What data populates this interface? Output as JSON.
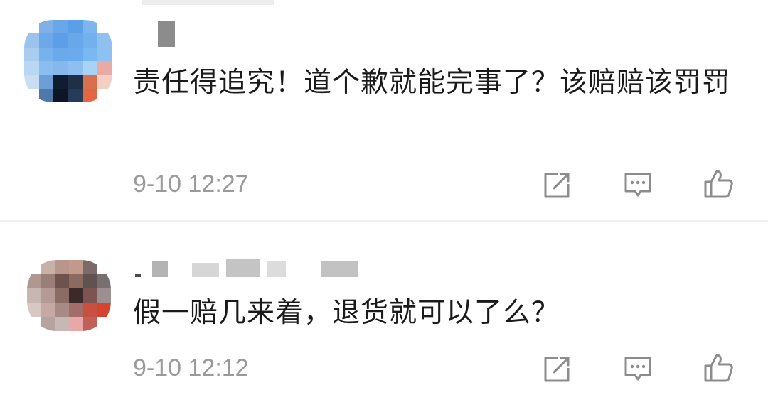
{
  "comments": [
    {
      "text": "责任得追究！道个歉就能完事了？该赔赔该罚罚",
      "time": "9-10 12:27"
    },
    {
      "text": "假一赔几来着，退货就可以了么？",
      "time": "9-10 12:12"
    }
  ],
  "icons": {
    "share": "share-icon",
    "reply": "comment-icon",
    "like": "thumbs-up-icon"
  },
  "colors": {
    "text": "#1a1a1a",
    "timestamp": "#9a9a9a",
    "icon": "#8c8c8c"
  }
}
